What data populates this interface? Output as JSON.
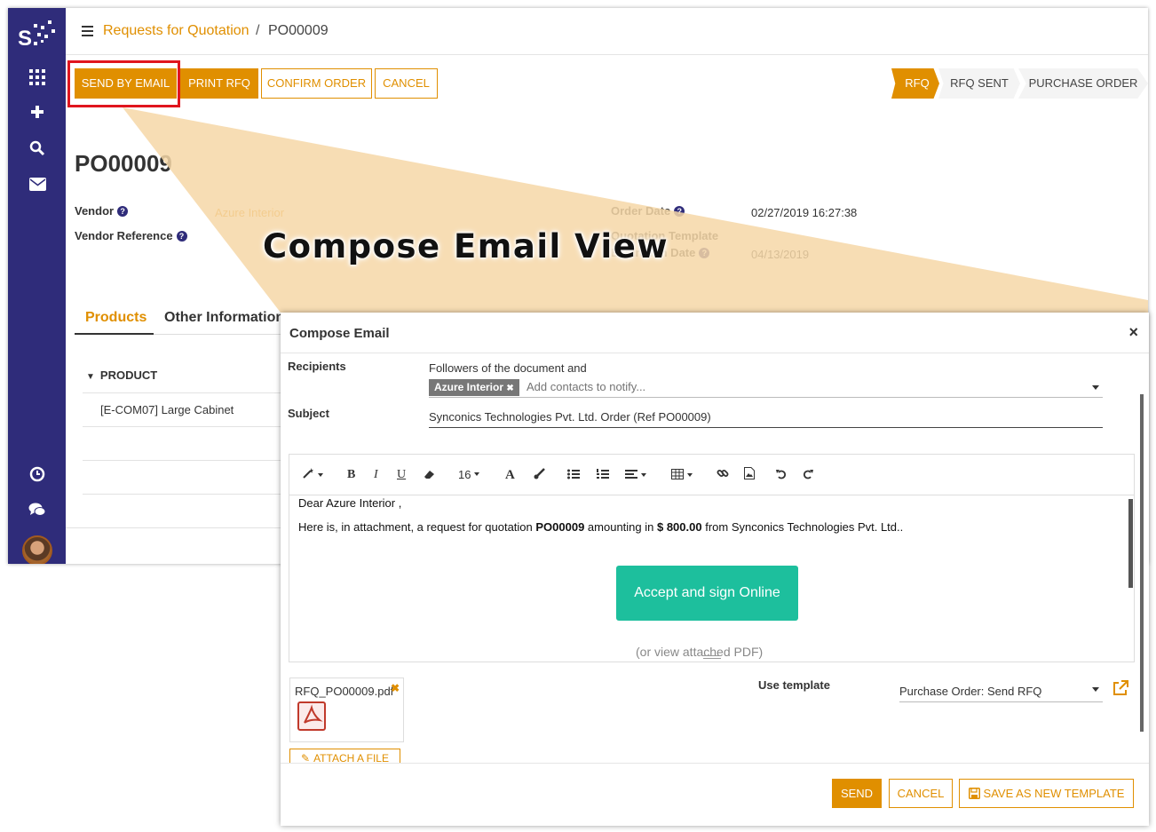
{
  "breadcrumb": {
    "link": "Requests for Quotation",
    "separator": "/",
    "current": "PO00009"
  },
  "actions": {
    "send_by_email": "SEND BY EMAIL",
    "print_rfq": "PRINT RFQ",
    "confirm_order": "CONFIRM ORDER",
    "cancel": "CANCEL"
  },
  "status": {
    "rfq": "RFQ",
    "rfq_sent": "RFQ SENT",
    "purchase_order": "PURCHASE ORDER"
  },
  "record": {
    "title": "PO00009",
    "vendor_label": "Vendor",
    "vendor_value": "Azure Interior",
    "vendor_ref_label": "Vendor Reference",
    "order_date_label": "Order Date",
    "order_date_value": "02/27/2019 16:27:38",
    "quotation_template_label": "Quotation Template",
    "expiration_label": "Expiration Date",
    "expiration_value": "04/13/2019"
  },
  "tabs": {
    "products": "Products",
    "other_info": "Other Information"
  },
  "table": {
    "column": "PRODUCT",
    "rows": [
      "[E-COM07] Large Cabinet"
    ]
  },
  "callout": "Compose Email View",
  "dialog": {
    "title": "Compose Email",
    "close": "×",
    "recipients_label": "Recipients",
    "recipients_text": "Followers of the document and",
    "recipient_tag": "Azure Interior",
    "recipient_tag_remove": "✖",
    "contacts_placeholder": "Add contacts to notify...",
    "subject_label": "Subject",
    "subject_value": "Synconics Technologies Pvt. Ltd. Order (Ref PO00009)",
    "font_size": "16",
    "body": {
      "greeting": "Dear Azure Interior ,",
      "line_prefix": "Here is, in attachment, a request for quotation ",
      "line_ref": "PO00009",
      "line_mid": " amounting in ",
      "line_amount": "$ 800.00",
      "line_suffix": " from Synconics Technologies Pvt. Ltd..",
      "accept_button": "Accept and sign Online",
      "pdf_note": "(or view attached PDF)"
    },
    "attachment_name": "RFQ_PO00009.pdf",
    "attachment_remove": "✖",
    "attach_file": "ATTACH A FILE",
    "use_template_label": "Use template",
    "template_value": "Purchase Order: Send RFQ",
    "send": "SEND",
    "cancel": "CANCEL",
    "save_template": "SAVE AS NEW TEMPLATE"
  },
  "colors": {
    "brand": "#e08f00",
    "sidebar": "#2f2c7a",
    "accept": "#1dbf9d",
    "highlight": "#e0151e",
    "callout_fill": "#f6d7a7"
  },
  "icons": [
    "apps-icon",
    "plus-icon",
    "search-icon",
    "mail-icon",
    "clock-icon",
    "chat-icon"
  ]
}
